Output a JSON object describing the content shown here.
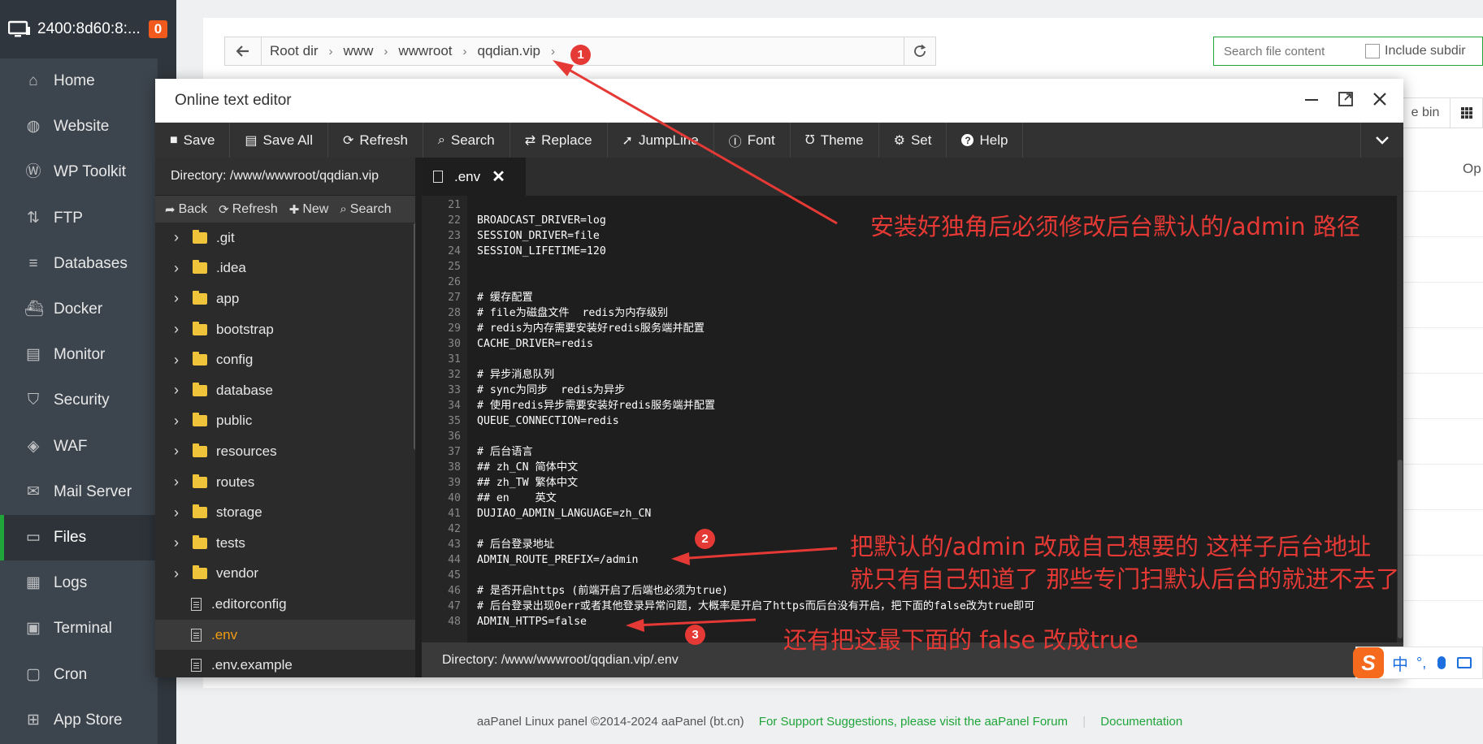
{
  "sidebar": {
    "server_name": "2400:8d60:8:...",
    "badge": "0",
    "items": [
      {
        "label": "Home",
        "icon": "home-icon"
      },
      {
        "label": "Website",
        "icon": "globe-icon"
      },
      {
        "label": "WP Toolkit",
        "icon": "wordpress-icon"
      },
      {
        "label": "FTP",
        "icon": "ftp-icon"
      },
      {
        "label": "Databases",
        "icon": "database-icon"
      },
      {
        "label": "Docker",
        "icon": "docker-icon"
      },
      {
        "label": "Monitor",
        "icon": "monitor-icon"
      },
      {
        "label": "Security",
        "icon": "shield-icon"
      },
      {
        "label": "WAF",
        "icon": "waf-shield-icon"
      },
      {
        "label": "Mail Server",
        "icon": "mail-icon"
      },
      {
        "label": "Files",
        "icon": "folder-icon"
      },
      {
        "label": "Logs",
        "icon": "logs-icon"
      },
      {
        "label": "Terminal",
        "icon": "terminal-icon"
      },
      {
        "label": "Cron",
        "icon": "calendar-icon"
      },
      {
        "label": "App Store",
        "icon": "apps-icon"
      }
    ],
    "active_index": 10
  },
  "breadcrumb": {
    "items": [
      "Root dir",
      "www",
      "wwwroot",
      "qqdian.vip"
    ]
  },
  "search": {
    "placeholder": "Search file content",
    "include_subdir": "Include subdir"
  },
  "background": {
    "recycle_bin_label": "e bin",
    "op_label": "Op"
  },
  "editor": {
    "title": "Online text editor",
    "toolbar": [
      {
        "label": "Save",
        "icon": "save-icon"
      },
      {
        "label": "Save All",
        "icon": "save-all-icon"
      },
      {
        "label": "Refresh",
        "icon": "refresh-icon"
      },
      {
        "label": "Search",
        "icon": "search-icon"
      },
      {
        "label": "Replace",
        "icon": "replace-icon"
      },
      {
        "label": "JumpLine",
        "icon": "jumpline-icon"
      },
      {
        "label": "Font",
        "icon": "font-icon"
      },
      {
        "label": "Theme",
        "icon": "theme-icon"
      },
      {
        "label": "Set",
        "icon": "gear-icon"
      },
      {
        "label": "Help",
        "icon": "help-icon"
      }
    ],
    "directory": "Directory: /www/wwwroot/qqdian.vip",
    "tree_toolbar": [
      "Back",
      "Refresh",
      "New",
      "Search"
    ],
    "tree": [
      {
        "name": ".git",
        "type": "folder"
      },
      {
        "name": ".idea",
        "type": "folder"
      },
      {
        "name": "app",
        "type": "folder"
      },
      {
        "name": "bootstrap",
        "type": "folder"
      },
      {
        "name": "config",
        "type": "folder"
      },
      {
        "name": "database",
        "type": "folder"
      },
      {
        "name": "public",
        "type": "folder"
      },
      {
        "name": "resources",
        "type": "folder"
      },
      {
        "name": "routes",
        "type": "folder"
      },
      {
        "name": "storage",
        "type": "folder"
      },
      {
        "name": "tests",
        "type": "folder"
      },
      {
        "name": "vendor",
        "type": "folder"
      },
      {
        "name": ".editorconfig",
        "type": "file"
      },
      {
        "name": ".env",
        "type": "file",
        "selected": true
      },
      {
        "name": ".env.example",
        "type": "file"
      }
    ],
    "tab": ".env",
    "code": [
      {
        "n": "21",
        "t": ""
      },
      {
        "n": "22",
        "t": "BROADCAST_DRIVER=log"
      },
      {
        "n": "23",
        "t": "SESSION_DRIVER=file"
      },
      {
        "n": "24",
        "t": "SESSION_LIFETIME=120"
      },
      {
        "n": "25",
        "t": ""
      },
      {
        "n": "26",
        "t": ""
      },
      {
        "n": "27",
        "t": "# 缓存配置"
      },
      {
        "n": "28",
        "t": "# file为磁盘文件  redis为内存级别"
      },
      {
        "n": "29",
        "t": "# redis为内存需要安装好redis服务端并配置"
      },
      {
        "n": "30",
        "t": "CACHE_DRIVER=redis"
      },
      {
        "n": "31",
        "t": ""
      },
      {
        "n": "32",
        "t": "# 异步消息队列"
      },
      {
        "n": "33",
        "t": "# sync为同步  redis为异步"
      },
      {
        "n": "34",
        "t": "# 使用redis异步需要安装好redis服务端并配置"
      },
      {
        "n": "35",
        "t": "QUEUE_CONNECTION=redis"
      },
      {
        "n": "36",
        "t": ""
      },
      {
        "n": "37",
        "t": "# 后台语言"
      },
      {
        "n": "38",
        "t": "## zh_CN 简体中文"
      },
      {
        "n": "39",
        "t": "## zh_TW 繁体中文"
      },
      {
        "n": "40",
        "t": "## en    英文"
      },
      {
        "n": "41",
        "t": "DUJIAO_ADMIN_LANGUAGE=zh_CN"
      },
      {
        "n": "42",
        "t": ""
      },
      {
        "n": "43",
        "t": "# 后台登录地址"
      },
      {
        "n": "44",
        "t": "ADMIN_ROUTE_PREFIX=/admin"
      },
      {
        "n": "45",
        "t": ""
      },
      {
        "n": "46",
        "t": "# 是否开启https (前端开启了后端也必须为true)"
      },
      {
        "n": "47",
        "t": "# 后台登录出现0err或者其他登录异常问题，大概率是开启了https而后台没有开启，把下面的false改为true即可"
      },
      {
        "n": "48",
        "t": "ADMIN_HTTPS=false"
      }
    ],
    "status": "Directory: /www/wwwroot/qqdian.vip/.env"
  },
  "annotations": {
    "markers": [
      "1",
      "2",
      "3"
    ],
    "note1": "安装好独角后必须修改后台默认的/admin 路径",
    "note2_line1": "把默认的/admin 改成自己想要的 这样子后台地址",
    "note2_line2": "就只有自己知道了  那些专门扫默认后台的就进不去了",
    "note3": "还有把这最下面的  false 改成true",
    "color": "#e53935"
  },
  "ime": {
    "logo": "S",
    "mode": "中",
    "punct": "°,"
  },
  "footer": {
    "copyright": "aaPanel Linux panel ©2014-2024 aaPanel (bt.cn)",
    "support": "For Support Suggestions, please visit the aaPanel Forum",
    "docs": "Documentation"
  },
  "colors": {
    "accent": "#20a53a",
    "sidebar_bg": "#3c444d",
    "editor_bg": "#1e1e1e",
    "badge": "#f25a1d"
  }
}
